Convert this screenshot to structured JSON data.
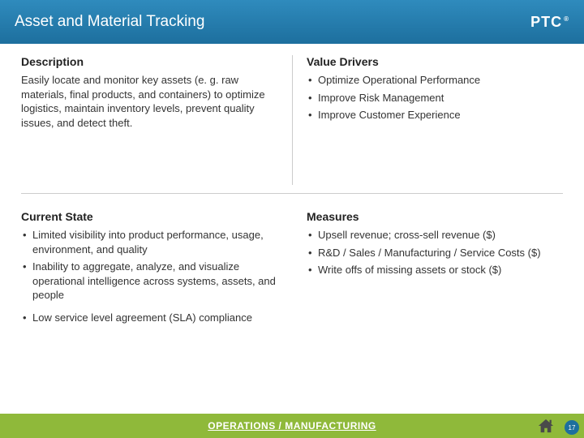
{
  "header": {
    "title": "Asset and Material Tracking",
    "logo_text": "PTC",
    "logo_reg": "®"
  },
  "sections": {
    "description": {
      "heading": "Description",
      "body": "Easily locate and monitor key assets (e. g. raw materials, final products, and containers) to optimize logistics, maintain inventory levels, prevent quality issues, and detect theft."
    },
    "value_drivers": {
      "heading": "Value Drivers",
      "items": [
        "Optimize Operational Performance",
        "Improve Risk Management",
        "Improve Customer Experience"
      ]
    },
    "current_state": {
      "heading": "Current State",
      "items": [
        "Limited visibility into product performance, usage, environment, and quality",
        "Inability to aggregate, analyze, and visualize operational intelligence across systems, assets, and people",
        "Low service level agreement (SLA) compliance"
      ]
    },
    "measures": {
      "heading": "Measures",
      "items": [
        "Upsell revenue; cross-sell revenue ($)",
        "R&D / Sales / Manufacturing / Service Costs ($)",
        "Write offs of missing assets or stock ($)"
      ]
    }
  },
  "footer": {
    "link_text": "OPERATIONS / MANUFACTURING",
    "page_number": "17"
  }
}
